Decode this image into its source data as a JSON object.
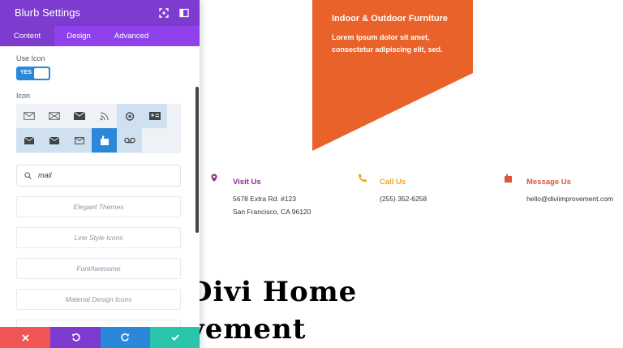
{
  "panel": {
    "title": "Blurb Settings",
    "tabs": [
      {
        "label": "Content",
        "active": true
      },
      {
        "label": "Design",
        "active": false
      },
      {
        "label": "Advanced",
        "active": false
      }
    ],
    "use_icon_label": "Use Icon",
    "toggle_label": "YES",
    "icon_label": "Icon",
    "search_value": "mail",
    "libraries": [
      "Elegant Themes",
      "Line Style Icons",
      "FontAwesome",
      "Material Design Icons"
    ],
    "footer_buttons": [
      "close-icon",
      "undo-icon",
      "redo-icon",
      "check-icon"
    ]
  },
  "colors": {
    "purple_header": "#7e3bd0",
    "purple_tabs": "#8f42ec",
    "accent_blue": "#2b87da",
    "banner_orange": "#e8622a",
    "visit_purple": "#8e2a8e",
    "call_orange": "#e8a62a",
    "message_red": "#d9583a",
    "btn_red": "#ef5555",
    "btn_purple": "#7e3bd0",
    "btn_blue": "#2b87da",
    "btn_green": "#29c4a9"
  },
  "banner": {
    "title": "Indoor & Outdoor Furniture",
    "text": "Lorem ipsum dolor sit amet, consectetur adipiscing elit, sed."
  },
  "contacts": [
    {
      "title": "Visit Us",
      "lines": [
        "5678 Extra Rd. #123",
        "San Francisco, CA 96120"
      ],
      "icon": "map-pin-icon"
    },
    {
      "title": "Call Us",
      "lines": [
        "(255) 352-6258"
      ],
      "icon": "phone-icon"
    },
    {
      "title": "Message Us",
      "lines": [
        "hello@diviimprovement.com"
      ],
      "icon": "mail-icon"
    }
  ],
  "heading": {
    "line1": "Divi Home",
    "line2": "vement"
  }
}
